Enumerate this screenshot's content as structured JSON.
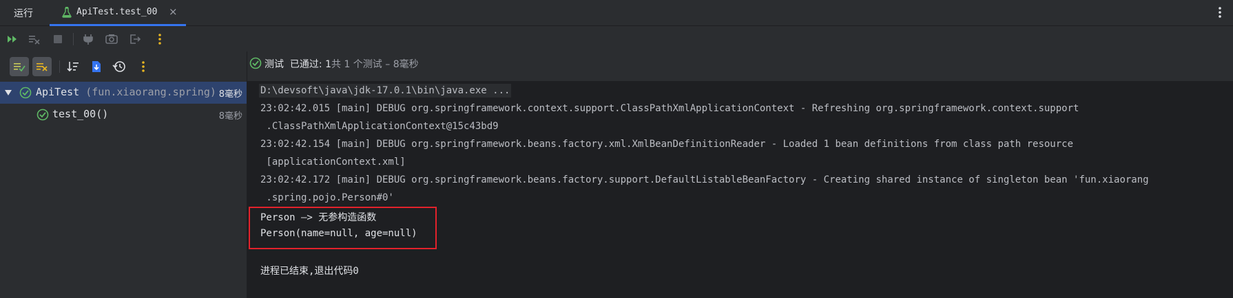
{
  "tabs": {
    "run_label": "运行",
    "active_tab_title": "ApiTest.test_00",
    "close_glyph": "×"
  },
  "toolbar": {
    "icons": [
      "rerun-icon",
      "rerun-failed-icon",
      "stop-icon",
      "attach-debugger-icon",
      "screenshot-icon",
      "exit-icon",
      "more-icon"
    ]
  },
  "left_toolbar": {
    "icons": [
      "show-passed-icon",
      "show-ignored-icon",
      "sort-icon",
      "import-tests-icon",
      "history-icon",
      "more-icon"
    ]
  },
  "tree": {
    "root": {
      "name": "ApiTest",
      "package": "(fun.xiaorang.spring)",
      "time": "8毫秒"
    },
    "child": {
      "name": "test_00()",
      "time": "8毫秒"
    }
  },
  "status": {
    "label": "测试",
    "passed_label": "已通过:",
    "passed_count": "1",
    "total_text": "共 1 个测试",
    "duration_text": "– 8毫秒"
  },
  "console": {
    "lines": [
      "D:\\devsoft\\java\\jdk-17.0.1\\bin\\java.exe ...",
      "23:02:42.015 [main] DEBUG org.springframework.context.support.ClassPathXmlApplicationContext - Refreshing org.springframework.context.support",
      " .ClassPathXmlApplicationContext@15c43bd9",
      "23:02:42.154 [main] DEBUG org.springframework.beans.factory.xml.XmlBeanDefinitionReader - Loaded 1 bean definitions from class path resource",
      " [applicationContext.xml]",
      "23:02:42.172 [main] DEBUG org.springframework.beans.factory.support.DefaultListableBeanFactory - Creating shared instance of singleton bean 'fun.xiaorang",
      " .spring.pojo.Person#0'",
      "Person –> 无参构造函数",
      "Person(name=null, age=null)",
      "进程已结束,退出代码0"
    ]
  },
  "colors": {
    "accent": "#3574f0",
    "success": "#5fb865",
    "highlight_border": "#e3222b",
    "selection": "#2e436e"
  }
}
